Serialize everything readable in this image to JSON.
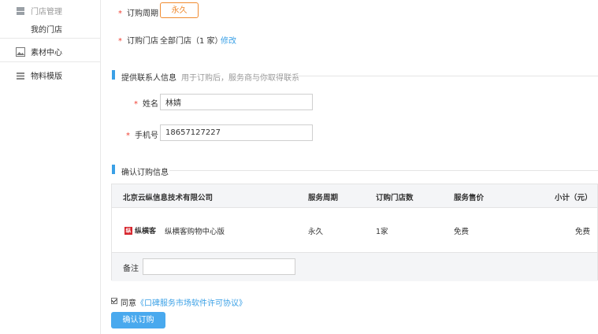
{
  "sidebar": {
    "store_manage": "门店管理",
    "my_store": "我的门店",
    "material_center": "素材中心",
    "material_template": "物料模版"
  },
  "order": {
    "period_label": "订购周期",
    "period_value": "永久",
    "store_label": "订购门店",
    "store_value": "全部门店（1 家）",
    "store_edit": "修改"
  },
  "contact": {
    "section_title": "提供联系人信息",
    "section_hint": "用于订购后，服务商与你取得联系",
    "name_label": "姓名",
    "name_value": "林婧",
    "phone_label": "手机号",
    "phone_value": "18657127227"
  },
  "confirm": {
    "section_title": "确认订购信息",
    "table": {
      "headers": [
        "北京云纵信息技术有限公司",
        "服务周期",
        "订购门店数",
        "服务售价",
        "小计（元）"
      ],
      "row": {
        "logo_mark": "纵",
        "logo_text": "纵横客",
        "product": "纵横客购物中心版",
        "period": "永久",
        "stores": "1家",
        "price": "免费",
        "subtotal": "免费"
      },
      "remark_label": "备注",
      "remark_value": ""
    }
  },
  "agreement": {
    "prefix": "同意",
    "link": "《口碑服务市场软件许可协议》",
    "checked": true
  },
  "submit_label": "确认订购",
  "colors": {
    "accent": "#3aa0e6",
    "orange": "#f08b30",
    "required": "#f04134"
  }
}
